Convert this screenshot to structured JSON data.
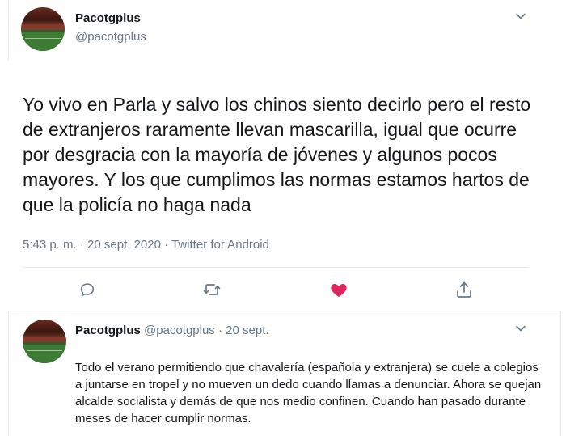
{
  "tweet": {
    "author_name": "Pacotgplus",
    "author_handle": "@pacotgplus",
    "text": "Yo vivo en Parla y salvo los chinos siento decirlo pero el resto de extranjeros raramente llevan mascarilla, igual que ocurre por desgracia con la mayoría de jóvenes y algunos pocos mayores. Y los que cumplimos las normas estamos hartos de que la policía no haga nada",
    "meta": "5:43 p. m. · 20 sept. 2020 · Twitter for Android",
    "liked": true,
    "like_color": "#e0245e"
  },
  "actions": {
    "icons": [
      "reply-icon",
      "retweet-icon",
      "like-icon",
      "share-icon"
    ]
  },
  "reply": {
    "author_name": "Pacotgplus",
    "author_handle": "@pacotgplus",
    "separator": " · ",
    "date": "20 sept.",
    "text": "Todo el verano permitiendo que chavalería (española y extranjera) se cuele a colegios a juntarse en tropel y no mueven un dedo cuando llamas a denunciar. Ahora se quejan alcalde socialista y demás de que nos medio confinen. Cuando han pasado durante meses de hacer cumplir normas."
  },
  "colors": {
    "text": "#14171a",
    "secondary": "#657786",
    "divider": "#e6ecf0",
    "icon": "#657786"
  }
}
